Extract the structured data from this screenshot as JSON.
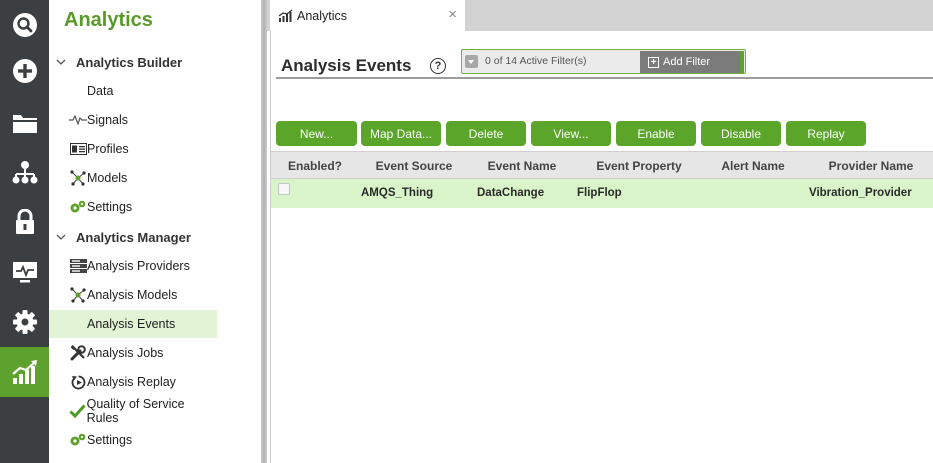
{
  "rail": {
    "items": [
      {
        "icon": "search-icon",
        "active": false
      },
      {
        "icon": "add-icon",
        "active": false
      },
      {
        "icon": "folder-icon",
        "active": false
      },
      {
        "icon": "hierarchy-icon",
        "active": false
      },
      {
        "icon": "lock-icon",
        "active": false
      },
      {
        "icon": "monitor-icon",
        "active": false
      },
      {
        "icon": "gear-icon",
        "active": false
      },
      {
        "icon": "analytics-chart-icon",
        "active": true
      }
    ],
    "accent": "#5fa12d",
    "background": "#3c3f42"
  },
  "nav": {
    "title": "Analytics",
    "sections": [
      {
        "label": "Analytics Builder",
        "items": [
          {
            "label": "Data",
            "icon": ""
          },
          {
            "label": "Signals",
            "icon": "signal-wave-icon"
          },
          {
            "label": "Profiles",
            "icon": "profile-card-icon"
          },
          {
            "label": "Models",
            "icon": "model-network-icon"
          },
          {
            "label": "Settings",
            "icon": "settings-gears-icon"
          }
        ]
      },
      {
        "label": "Analytics Manager",
        "items": [
          {
            "label": "Analysis Providers",
            "icon": "server-stack-icon"
          },
          {
            "label": "Analysis Models",
            "icon": "model-network-icon"
          },
          {
            "label": "Analysis Events",
            "icon": "",
            "active": true
          },
          {
            "label": "Analysis Jobs",
            "icon": "tools-icon"
          },
          {
            "label": "Analysis Replay",
            "icon": "replay-icon"
          },
          {
            "label": "Quality of Service Rules",
            "icon": "checkmark-icon"
          },
          {
            "label": "Settings",
            "icon": "settings-gears-icon"
          }
        ]
      }
    ]
  },
  "tab": {
    "label": "Analytics",
    "close": "×"
  },
  "page": {
    "title": "Analysis Events",
    "help": "?"
  },
  "filter": {
    "status": "0 of 14 Active Filter(s)",
    "add_label": "Add Filter"
  },
  "toolbar": {
    "buttons": [
      "New...",
      "Map Data...",
      "Delete",
      "View...",
      "Enable",
      "Disable",
      "Replay"
    ]
  },
  "grid": {
    "columns": [
      "Enabled?",
      "Event Source",
      "Event Name",
      "Event Property",
      "Alert Name",
      "Provider Name"
    ],
    "rows": [
      {
        "enabled": false,
        "event_source": "AMQS_Thing",
        "event_name": "DataChange",
        "event_property": "FlipFlop",
        "alert_name": "",
        "provider_name": "Vibration_Provider"
      }
    ]
  }
}
